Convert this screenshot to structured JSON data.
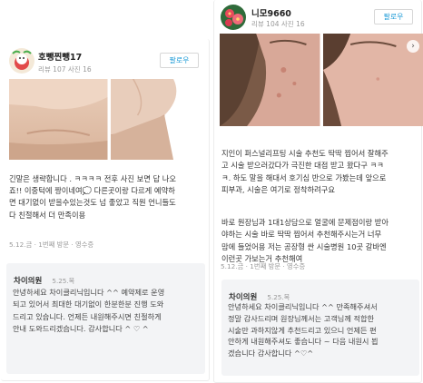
{
  "left_review": {
    "username": "호뺑찐뺑17",
    "meta": "리뷰 107  사진 16",
    "follow_label": "팔로우",
    "review_text": "긴말은 생략합니다 . ㅋㅋㅋㅋ 전후 사진 보면 답 나오\n죠!! 이중턱에 짱이네여💭 다른곳이랑 다르게 예약하\n면 대기없이 받을수있는것도 넘 좋았고 직원 언니들도\n다 친절해서 더 만족이용",
    "tags": [
      "5.12.금",
      "1번째 방문",
      "영수증"
    ],
    "reply": {
      "name": "차이의원",
      "date": "5.25.목",
      "text": "안녕하세요 차이클리닉입니다 ^^ 예약제로 운영\n되고 있어서 최대한 대기없이 한분한분 진행 도와\n드리고 있습니다. 언제든 내원해주시면 친절하게\n안내 도와드리겠습니다. 감사합니다 ^ ♡ ^"
    }
  },
  "right_review": {
    "username": "니모9660",
    "meta": "리뷰 104  사진 16",
    "follow_label": "팔로우",
    "photo_next_icon": "chevron-right-icon",
    "review_paragraphs": [
      "지인이 퍼스널리프팅 시술 추천도 딱딱 찝어서 잘해주\n고 시술 받으러갔다가 극진한 대접 받고 왔다구 ㅋㅋ\nㅋ. 하도 말을 해대서 호기심 반으로 가봤는데 앞으로\n피부과, 시술은 여기로 정착하려구요",
      "바로 원장님과 1대1상담으로 얼굴에 문제점이랑 받아\n야하는 시술 바로 딱딱 찝어서 추천해주시는거 너무\n맘에 들었어용 저는 공장형 싼 시술병원 10곳 갈바엔\n이런곳 가보는거 추천해여"
    ],
    "tags": [
      "5.12.금",
      "1번째 방문",
      "영수증"
    ],
    "reply": {
      "name": "차이의원",
      "date": "5.25.목",
      "text": "안녕하세요 차이클리닉입니다 ^^ 만족해주셔서\n정말 감사드리며 원장님께서는 고객님께 적합한\n시술만 과하지않게 추천드리고 있으니 언제든 편\n안하게 내원해주셔도 좋습니다 ~ 다음 내원시 뵙\n겠습니다 감사합니다 ^♡^"
    }
  }
}
